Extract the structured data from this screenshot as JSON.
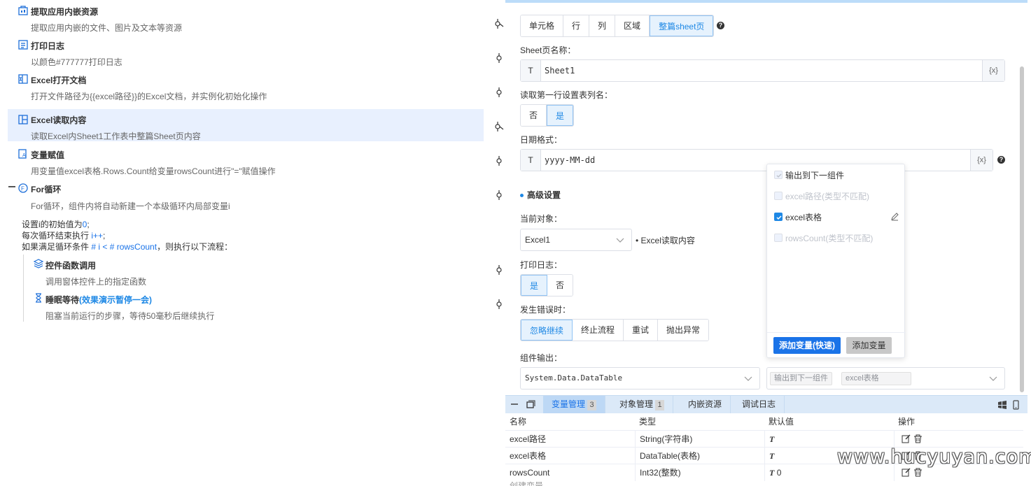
{
  "flow": {
    "steps": [
      {
        "title": "提取应用内嵌资源",
        "desc": "提取应用内嵌的文件、图片及文本等资源",
        "icon": "extract-resource-icon"
      },
      {
        "title": "打印日志",
        "desc": "以颜色#777777打印日志",
        "icon": "print-log-icon"
      },
      {
        "title": "Excel打开文档",
        "desc": "打开文件路径为{{excel路径}}的Excel文档，并实例化初始化操作",
        "icon": "excel-open-icon"
      },
      {
        "title": "Excel读取内容",
        "desc": "读取Excel内Sheet1工作表中整篇Sheet页内容",
        "icon": "excel-read-icon"
      },
      {
        "title": "变量赋值",
        "desc": "用变量值excel表格.Rows.Count给变量rowsCount进行\"=\"赋值操作",
        "icon": "variable-assign-icon"
      },
      {
        "title": "For循环",
        "desc": "For循环，组件内将自动新建一个本级循环内局部变量i",
        "icon": "for-loop-icon"
      }
    ],
    "loop": {
      "l1_a": "设置i的初始值为",
      "l1_v": "0",
      "l1_b": ";",
      "l2_a": "每次循环结束执行 ",
      "l2_v": "i++",
      "l2_b": ";",
      "l3_a": "如果满足循环条件 ",
      "l3_v": "# i < # rowsCount",
      "l3_b": "，则执行以下流程："
    },
    "sub": [
      {
        "title": "控件函数调用",
        "title_hl": "",
        "desc": "调用窗体控件上的指定函数"
      },
      {
        "title": "睡眠等待",
        "title_hl": "(效果演示暂停一会)",
        "desc": "阻塞当前运行的步骤，等待50毫秒后继续执行"
      }
    ]
  },
  "panel": {
    "scope_tabs": [
      "单元格",
      "行",
      "列",
      "区域",
      "整篇sheet页"
    ],
    "scope_active": 4,
    "sheet_label": "Sheet页名称：",
    "sheet_prefix": "T",
    "sheet_value": "Sheet1",
    "var_btn": "{x}",
    "header_label": "读取第一行设置表列名：",
    "header_opts": [
      "否",
      "是"
    ],
    "date_label": "日期格式：",
    "date_prefix": "T",
    "date_value": "yyyy-MM-dd",
    "advanced": "高级设置",
    "obj_label": "当前对象：",
    "obj_value": "Excel1",
    "obj_note": "Excel读取内容",
    "log_label": "打印日志：",
    "log_opts": [
      "是",
      "否"
    ],
    "err_label": "发生错误时：",
    "err_opts": [
      "忽略继续",
      "终止流程",
      "重试",
      "抛出异常"
    ],
    "out_label": "组件输出：",
    "out_type": "System.Data.DataTable",
    "out_tags": [
      "输出到下一组件",
      "excel表格"
    ],
    "help": "?"
  },
  "popover": {
    "items": [
      {
        "label": "输出到下一组件",
        "state": "disabled-checked"
      },
      {
        "label": "excel路径(类型不匹配)",
        "state": "disabled"
      },
      {
        "label": "excel表格",
        "state": "checked"
      },
      {
        "label": "rowsCount(类型不匹配)",
        "state": "disabled"
      }
    ],
    "btn_quick": "添加变量(快速)",
    "btn_add": "添加变量"
  },
  "bottom": {
    "tabs": [
      {
        "label": "变量管理",
        "count": "3"
      },
      {
        "label": "对象管理",
        "count": "1"
      },
      {
        "label": "内嵌资源",
        "count": ""
      },
      {
        "label": "调试日志",
        "count": ""
      }
    ],
    "headers": [
      "名称",
      "类型",
      "默认值",
      "操作"
    ],
    "rows": [
      {
        "name": "excel路径",
        "type": "String(字符串)",
        "t": "T",
        "default": ""
      },
      {
        "name": "excel表格",
        "type": "DataTable(表格)",
        "t": "T",
        "default": ""
      },
      {
        "name": "rowsCount",
        "type": "Int32(整数)",
        "t": "T",
        "default": "0"
      }
    ],
    "partial": "创建变量"
  },
  "watermark": "www.hucyuyan.com",
  "colors": {
    "accent": "#1e88e5",
    "selected_bg": "#e8f0fe",
    "tabbar_bg": "#dbe9f8"
  }
}
